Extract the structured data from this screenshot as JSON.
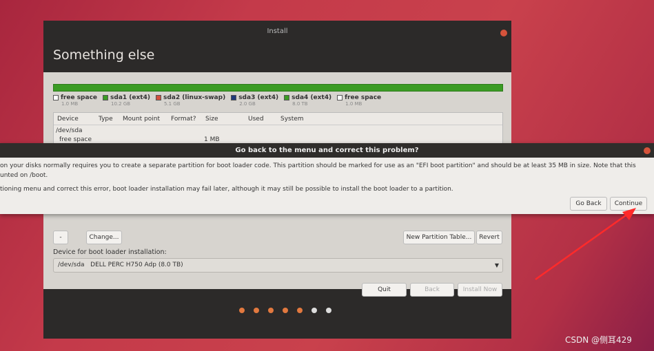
{
  "window": {
    "title": "Install",
    "header": "Something else"
  },
  "legend": [
    {
      "label": "free space",
      "size": "1.0 MB",
      "color": "#ffffff"
    },
    {
      "label": "sda1 (ext4)",
      "size": "10.2 GB",
      "color": "#3b9c24"
    },
    {
      "label": "sda2 (linux-swap)",
      "size": "5.1 GB",
      "color": "#d3513f"
    },
    {
      "label": "sda3 (ext4)",
      "size": "2.0 GB",
      "color": "#213a7a"
    },
    {
      "label": "sda4 (ext4)",
      "size": "8.0 TB",
      "color": "#3b9c24"
    },
    {
      "label": "free space",
      "size": "1.0 MB",
      "color": "#ffffff"
    }
  ],
  "table": {
    "headers": [
      "Device",
      "Type",
      "Mount point",
      "Format?",
      "Size",
      "Used",
      "System"
    ],
    "rows": [
      {
        "device": "/dev/sda"
      },
      {
        "device": "free space",
        "size": "1 MB"
      }
    ]
  },
  "buttons_partial": {
    "change": "Change...",
    "new_table": "New Partition Table...",
    "revert": "Revert"
  },
  "bootloader": {
    "label": "Device for boot loader installation:",
    "device": "/dev/sda",
    "desc": "DELL PERC H750 Adp (8.0 TB)"
  },
  "nav": {
    "quit": "Quit",
    "back": "Back",
    "install": "Install Now"
  },
  "progress": {
    "total_steps": 7,
    "completed_steps": 5,
    "active_color": "#e2793f",
    "inactive_color": "#dddddd"
  },
  "dialog": {
    "title": "Go back to the menu and correct this problem?",
    "line1": "on your disks normally requires you to create a separate partition for boot loader code. This partition should be marked for use as an \"EFI boot partition\" and should be at least 35 MB in size. Note that this",
    "line2": "unted on /boot.",
    "line3": "tioning menu and correct this error, boot loader installation may fail later, although it may still be possible to install the boot loader to a partition.",
    "go_back": "Go Back",
    "continue": "Continue"
  },
  "watermark": "CSDN @侧耳429"
}
